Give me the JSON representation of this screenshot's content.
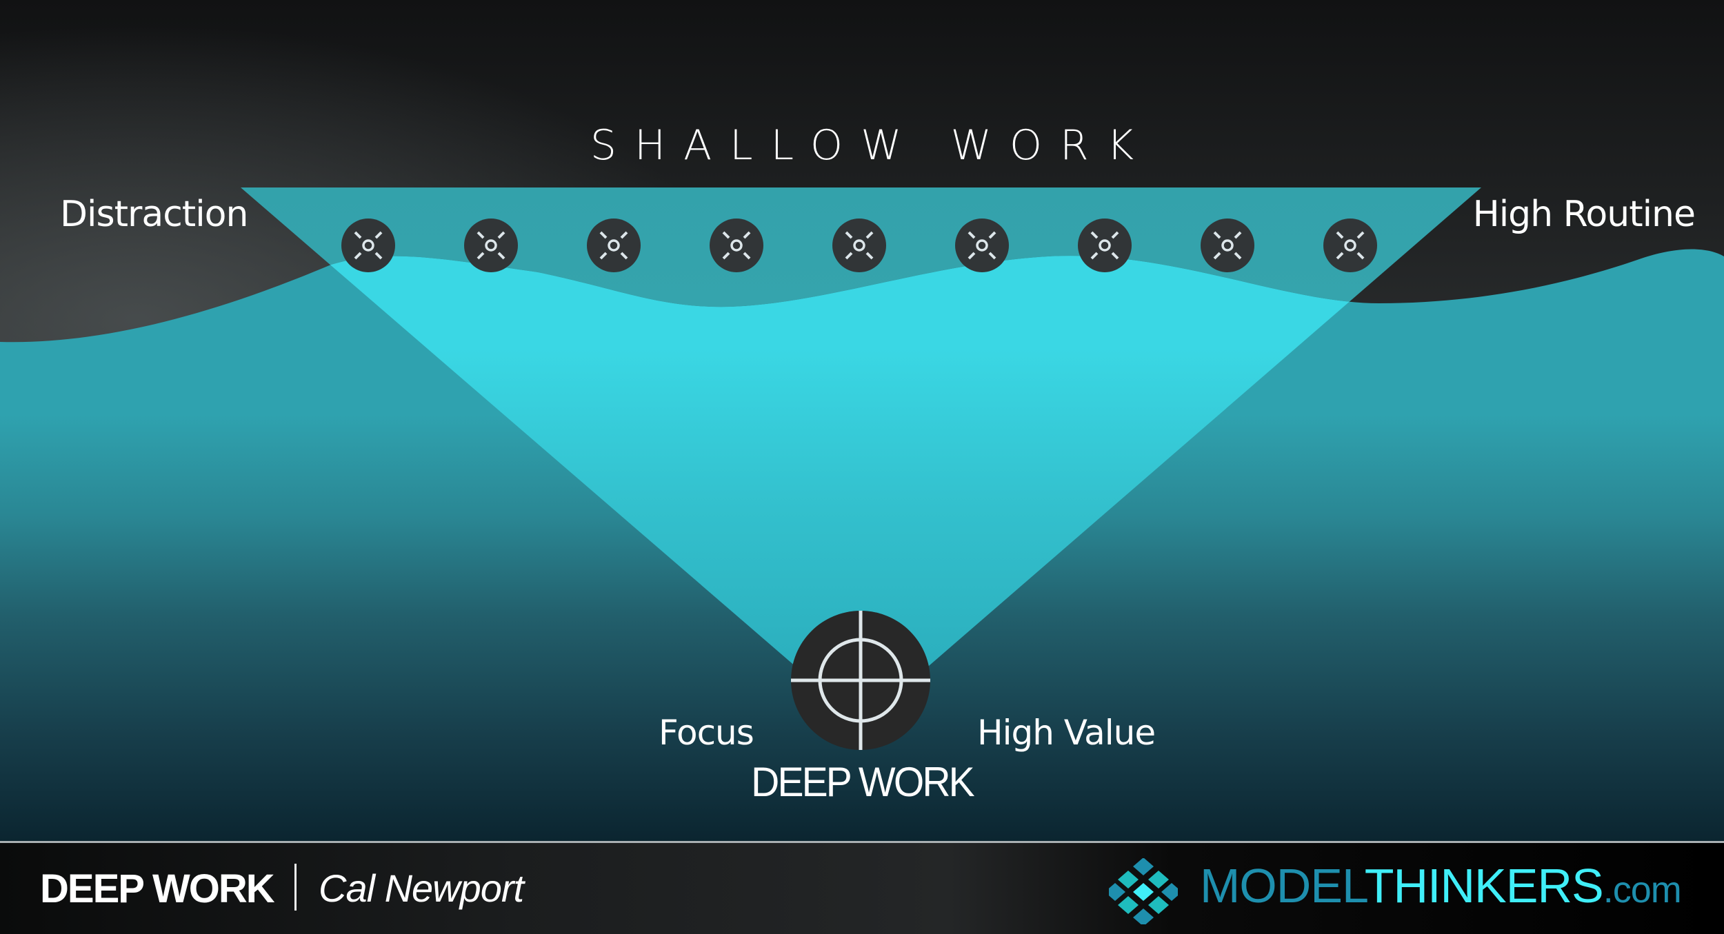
{
  "diagram": {
    "title": "SHALLOW WORK",
    "top_left_label": "Distraction",
    "top_right_label": "High Routine",
    "bottom_left_label": "Focus",
    "bottom_right_label": "High Value",
    "bottom_title": "DEEP WORK",
    "shallow_icon_count": 9,
    "shallow_icon": "scattered-focus-icon",
    "deep_icon": "crosshair-target-icon",
    "colors": {
      "sky_top": "#121314",
      "sky_mid": "#45494a",
      "water_light": "#38d6e3",
      "water_dark": "#0b2430",
      "funnel": "#33c9d6",
      "icon_fill": "#313537",
      "icon_glyph": "#dde6ea"
    }
  },
  "footer": {
    "title": "DEEP WORK",
    "author": "Cal Newport",
    "brand_part1": "MODEL",
    "brand_part2": "THINKERS",
    "brand_suffix": ".com",
    "logo_icon": "diamond-grid-logo",
    "colors": {
      "brand_dark": "#1e8fae",
      "brand_light": "#40eef8",
      "logo_mid": "#1fbcbe"
    }
  }
}
